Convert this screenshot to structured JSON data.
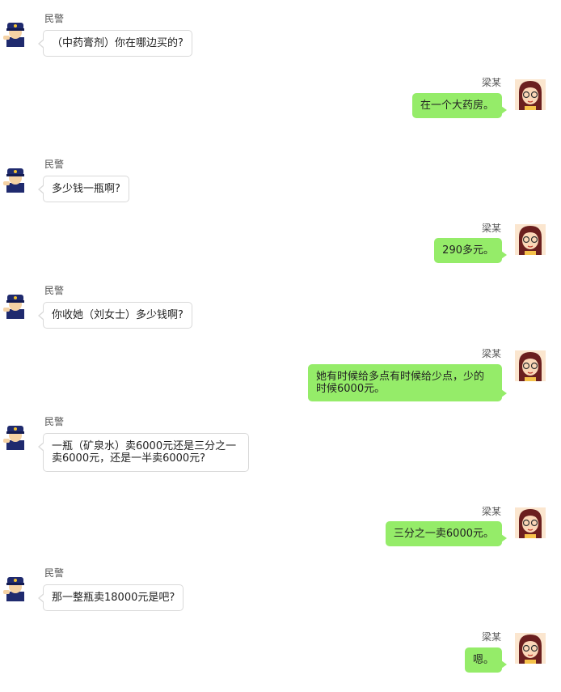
{
  "chat": {
    "messages": [
      {
        "sender": "民警",
        "text": "（中药膏剂）你在哪边买的?"
      },
      {
        "sender": "梁某",
        "text": "在一个大药房。"
      },
      {
        "sender": "民警",
        "text": "多少钱一瓶啊?"
      },
      {
        "sender": "梁某",
        "text": "290多元。"
      },
      {
        "sender": "民警",
        "text": "你收她（刘女士）多少钱啊?"
      },
      {
        "sender": "梁某",
        "text": "她有时候给多点有时候给少点，少的时候6000元。"
      },
      {
        "sender": "民警",
        "text": "一瓶（矿泉水）卖6000元还是三分之一卖6000元，还是一半卖6000元?"
      },
      {
        "sender": "梁某",
        "text": "三分之一卖6000元。"
      },
      {
        "sender": "民警",
        "text": "那一整瓶卖18000元是吧?"
      },
      {
        "sender": "梁某",
        "text": "嗯。"
      }
    ]
  },
  "colors": {
    "self_bubble": "#95ec69",
    "other_bubble": "#ffffff",
    "other_border": "#d9d9d9"
  },
  "icons": {
    "police_avatar": "police-officer-avatar-icon",
    "girl_avatar": "girl-with-glasses-avatar-icon"
  }
}
